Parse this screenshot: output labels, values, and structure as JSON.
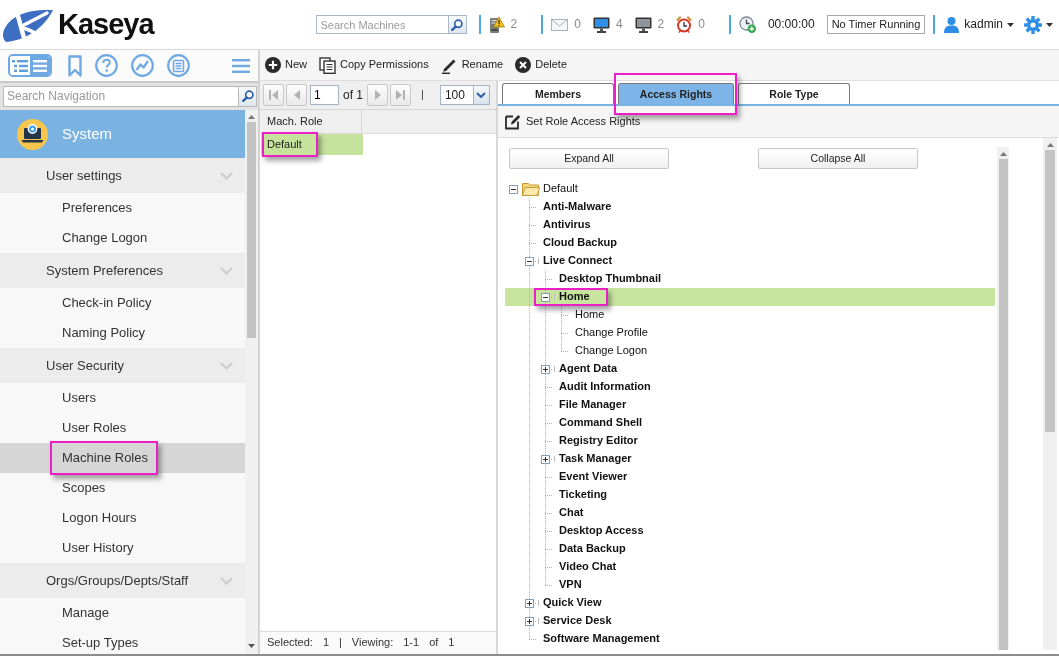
{
  "header": {
    "logo": "Kaseya",
    "search": {
      "placeholder": "Search Machines"
    },
    "counter_groups": [
      [
        {
          "kind": "server-alert",
          "count": "2"
        }
      ],
      [
        {
          "kind": "mail",
          "count": "0"
        },
        {
          "kind": "monitor-online",
          "count": "4"
        },
        {
          "kind": "monitor-offline",
          "count": "2"
        },
        {
          "kind": "alarm",
          "count": "0"
        }
      ]
    ],
    "timer": {
      "elapsed": "00:00:00",
      "status": "No Timer Running"
    },
    "user": {
      "name": "kadmin"
    }
  },
  "nav": {
    "views": [
      {
        "kind": "tree",
        "selected": false
      },
      {
        "kind": "list",
        "selected": true
      }
    ],
    "search": {
      "placeholder": "Search Navigation"
    },
    "module": "System",
    "sections": [
      {
        "title": "User settings",
        "expanded": true,
        "items": [
          {
            "label": "Preferences",
            "selected": false,
            "callout": false
          },
          {
            "label": "Change Logon",
            "selected": false,
            "callout": false
          }
        ]
      },
      {
        "title": "System Preferences",
        "expanded": true,
        "items": [
          {
            "label": "Check-in Policy",
            "selected": false,
            "callout": false
          },
          {
            "label": "Naming Policy",
            "selected": false,
            "callout": false
          }
        ]
      },
      {
        "title": "User Security",
        "expanded": true,
        "items": [
          {
            "label": "Users",
            "selected": false,
            "callout": false
          },
          {
            "label": "User Roles",
            "selected": false,
            "callout": false
          },
          {
            "label": "Machine Roles",
            "selected": true,
            "callout": true
          },
          {
            "label": "Scopes",
            "selected": false,
            "callout": false
          },
          {
            "label": "Logon Hours",
            "selected": false,
            "callout": false
          },
          {
            "label": "User History",
            "selected": false,
            "callout": false
          }
        ]
      },
      {
        "title": "Orgs/Groups/Depts/Staff",
        "expanded": true,
        "items": [
          {
            "label": "Manage",
            "selected": false,
            "callout": false
          },
          {
            "label": "Set-up Types",
            "selected": false,
            "callout": false
          }
        ]
      }
    ]
  },
  "toolbar": [
    {
      "kind": "new",
      "label": "New"
    },
    {
      "kind": "copy",
      "label": "Copy Permissions"
    },
    {
      "kind": "rename",
      "label": "Rename"
    },
    {
      "kind": "delete",
      "label": "Delete"
    }
  ],
  "roles": {
    "pager": {
      "back": [
        {
          "kind": "first",
          "disabled": true
        },
        {
          "kind": "previous",
          "disabled": true
        }
      ],
      "page": "1",
      "page_count": "of 1",
      "forward": [
        {
          "kind": "next",
          "disabled": true
        },
        {
          "kind": "last",
          "disabled": true
        }
      ],
      "separator": "|",
      "page_size": "100"
    },
    "columns": [
      "Mach. Role"
    ],
    "rows": [
      {
        "cells": [
          "Default"
        ],
        "selected": true,
        "callout": true
      }
    ],
    "footer": [
      "Selected:",
      "1",
      "|",
      "Viewing:",
      "1-1",
      "of",
      "1"
    ]
  },
  "tabs": [
    {
      "label": "Members",
      "selected": false,
      "callout": false
    },
    {
      "label": "Access Rights",
      "selected": true,
      "callout": true
    },
    {
      "label": "Role Type",
      "selected": false,
      "callout": false
    }
  ],
  "access": {
    "action": "Set Role Access Rights",
    "buttons": [
      "Expand All",
      "Collapse All"
    ],
    "tree": [
      {
        "label": "Default",
        "kind": "folder",
        "expanded": true,
        "bold": false,
        "selected": false,
        "callout": false,
        "children": [
          {
            "label": "Anti-Malware",
            "kind": "leaf",
            "bold": true,
            "selected": false,
            "callout": false
          },
          {
            "label": "Antivirus",
            "kind": "leaf",
            "bold": true,
            "selected": false,
            "callout": false
          },
          {
            "label": "Cloud Backup",
            "kind": "leaf",
            "bold": true,
            "selected": false,
            "callout": false
          },
          {
            "label": "Live Connect",
            "kind": "group",
            "expanded": true,
            "bold": true,
            "selected": false,
            "callout": false,
            "children": [
              {
                "label": "Desktop Thumbnail",
                "kind": "leaf",
                "bold": true,
                "selected": false,
                "callout": false
              },
              {
                "label": "Home",
                "kind": "group",
                "expanded": true,
                "bold": true,
                "selected": true,
                "callout": true,
                "children": [
                  {
                    "label": "Home",
                    "kind": "leaf",
                    "bold": false,
                    "selected": false,
                    "callout": false
                  },
                  {
                    "label": "Change Profile",
                    "kind": "leaf",
                    "bold": false,
                    "selected": false,
                    "callout": false
                  },
                  {
                    "label": "Change Logon",
                    "kind": "leaf",
                    "bold": false,
                    "selected": false,
                    "callout": false
                  }
                ]
              },
              {
                "label": "Agent Data",
                "kind": "group",
                "expanded": false,
                "bold": true,
                "selected": false,
                "callout": false
              },
              {
                "label": "Audit Information",
                "kind": "leaf",
                "bold": true,
                "selected": false,
                "callout": false
              },
              {
                "label": "File Manager",
                "kind": "leaf",
                "bold": true,
                "selected": false,
                "callout": false
              },
              {
                "label": "Command Shell",
                "kind": "leaf",
                "bold": true,
                "selected": false,
                "callout": false
              },
              {
                "label": "Registry Editor",
                "kind": "leaf",
                "bold": true,
                "selected": false,
                "callout": false
              },
              {
                "label": "Task Manager",
                "kind": "group",
                "expanded": false,
                "bold": true,
                "selected": false,
                "callout": false
              },
              {
                "label": "Event Viewer",
                "kind": "leaf",
                "bold": true,
                "selected": false,
                "callout": false
              },
              {
                "label": "Ticketing",
                "kind": "leaf",
                "bold": true,
                "selected": false,
                "callout": false
              },
              {
                "label": "Chat",
                "kind": "leaf",
                "bold": true,
                "selected": false,
                "callout": false
              },
              {
                "label": "Desktop Access",
                "kind": "leaf",
                "bold": true,
                "selected": false,
                "callout": false
              },
              {
                "label": "Data Backup",
                "kind": "leaf",
                "bold": true,
                "selected": false,
                "callout": false
              },
              {
                "label": "Video Chat",
                "kind": "leaf",
                "bold": true,
                "selected": false,
                "callout": false
              },
              {
                "label": "VPN",
                "kind": "leaf",
                "bold": true,
                "selected": false,
                "callout": false
              }
            ]
          },
          {
            "label": "Quick View",
            "kind": "group",
            "expanded": false,
            "bold": true,
            "selected": false,
            "callout": false
          },
          {
            "label": "Service Desk",
            "kind": "group",
            "expanded": false,
            "bold": true,
            "selected": false,
            "callout": false
          },
          {
            "label": "Software Management",
            "kind": "leaf",
            "bold": true,
            "selected": false,
            "callout": false
          }
        ]
      }
    ]
  }
}
